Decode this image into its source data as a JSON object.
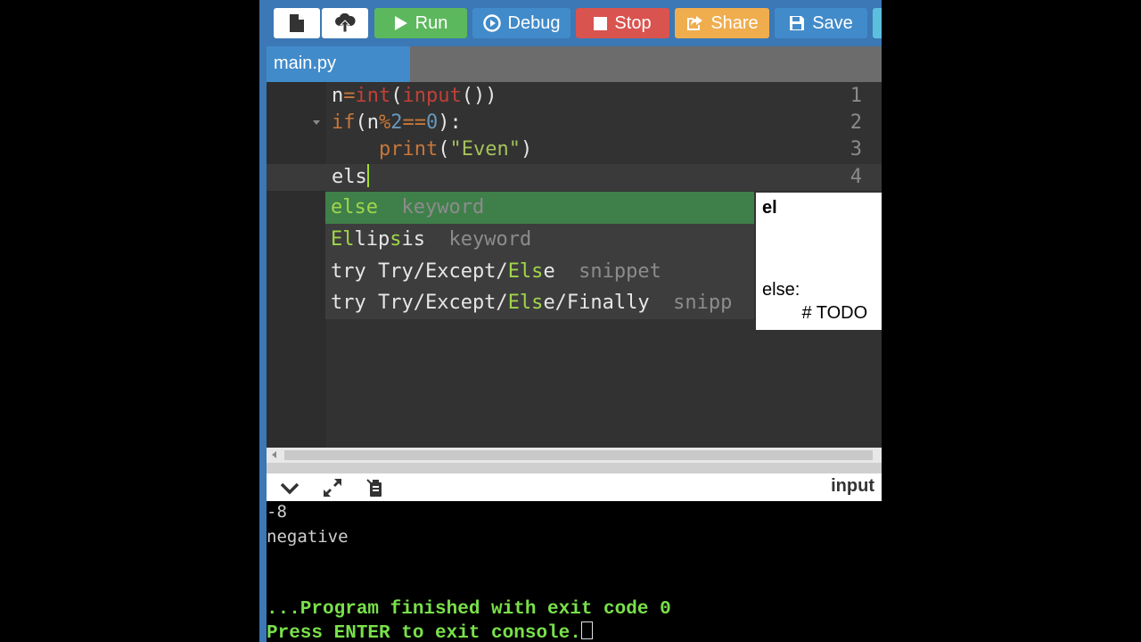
{
  "toolbar": {
    "run_label": "Run",
    "debug_label": "Debug",
    "stop_label": "Stop",
    "share_label": "Share",
    "save_label": "Save",
    "colors": {
      "bar": "#3b78b5",
      "run": "#5cb85c",
      "debug": "#428bca",
      "stop": "#d9534f",
      "share": "#f0ad4e",
      "save": "#428bca"
    }
  },
  "tabs": [
    {
      "label": "main.py",
      "active": true
    }
  ],
  "editor": {
    "line_numbers": [
      "1",
      "2",
      "3",
      "4"
    ],
    "lines": [
      {
        "tokens": [
          {
            "t": "n",
            "c": "plain"
          },
          {
            "t": "=",
            "c": "op"
          },
          {
            "t": "int",
            "c": "fn"
          },
          {
            "t": "(",
            "c": "plain"
          },
          {
            "t": "input",
            "c": "fn"
          },
          {
            "t": "())",
            "c": "plain"
          }
        ]
      },
      {
        "tokens": [
          {
            "t": "if",
            "c": "kw"
          },
          {
            "t": "(n",
            "c": "plain"
          },
          {
            "t": "%",
            "c": "op"
          },
          {
            "t": "2",
            "c": "num"
          },
          {
            "t": "==",
            "c": "op"
          },
          {
            "t": "0",
            "c": "num"
          },
          {
            "t": "):",
            "c": "plain"
          }
        ]
      },
      {
        "tokens": [
          {
            "t": "    ",
            "c": "plain"
          },
          {
            "t": "print",
            "c": "kw"
          },
          {
            "t": "(",
            "c": "plain"
          },
          {
            "t": "\"Even\"",
            "c": "str"
          },
          {
            "t": ")",
            "c": "plain"
          }
        ]
      },
      {
        "tokens": [
          {
            "t": "els",
            "c": "plain"
          }
        ]
      }
    ],
    "active_line": 4
  },
  "autocomplete": {
    "items": [
      {
        "parts": [
          {
            "t": "else",
            "c": "hl"
          }
        ],
        "meta": "keyword",
        "selected": true
      },
      {
        "parts": [
          {
            "t": "El",
            "c": "hl"
          },
          {
            "t": "lip",
            "c": "plain"
          },
          {
            "t": "s",
            "c": "hl"
          },
          {
            "t": "is",
            "c": "plain"
          }
        ],
        "meta": "keyword",
        "selected": false
      },
      {
        "parts": [
          {
            "t": "try Try/Except/",
            "c": "plain"
          },
          {
            "t": "Els",
            "c": "hl"
          },
          {
            "t": "e",
            "c": "plain"
          }
        ],
        "meta": "snippet",
        "selected": false
      },
      {
        "parts": [
          {
            "t": "try Try/Except/",
            "c": "plain"
          },
          {
            "t": "Els",
            "c": "hl"
          },
          {
            "t": "e/Finally",
            "c": "plain"
          }
        ],
        "meta": "snipp",
        "selected": false
      }
    ],
    "doc_title": "el",
    "doc_body": "else:\n        # TODO"
  },
  "console": {
    "input_label": "input",
    "output_lines": [
      "-8",
      "negative"
    ],
    "finish_message": "...Program finished with exit code 0",
    "prompt_message": "Press ENTER to exit console."
  }
}
